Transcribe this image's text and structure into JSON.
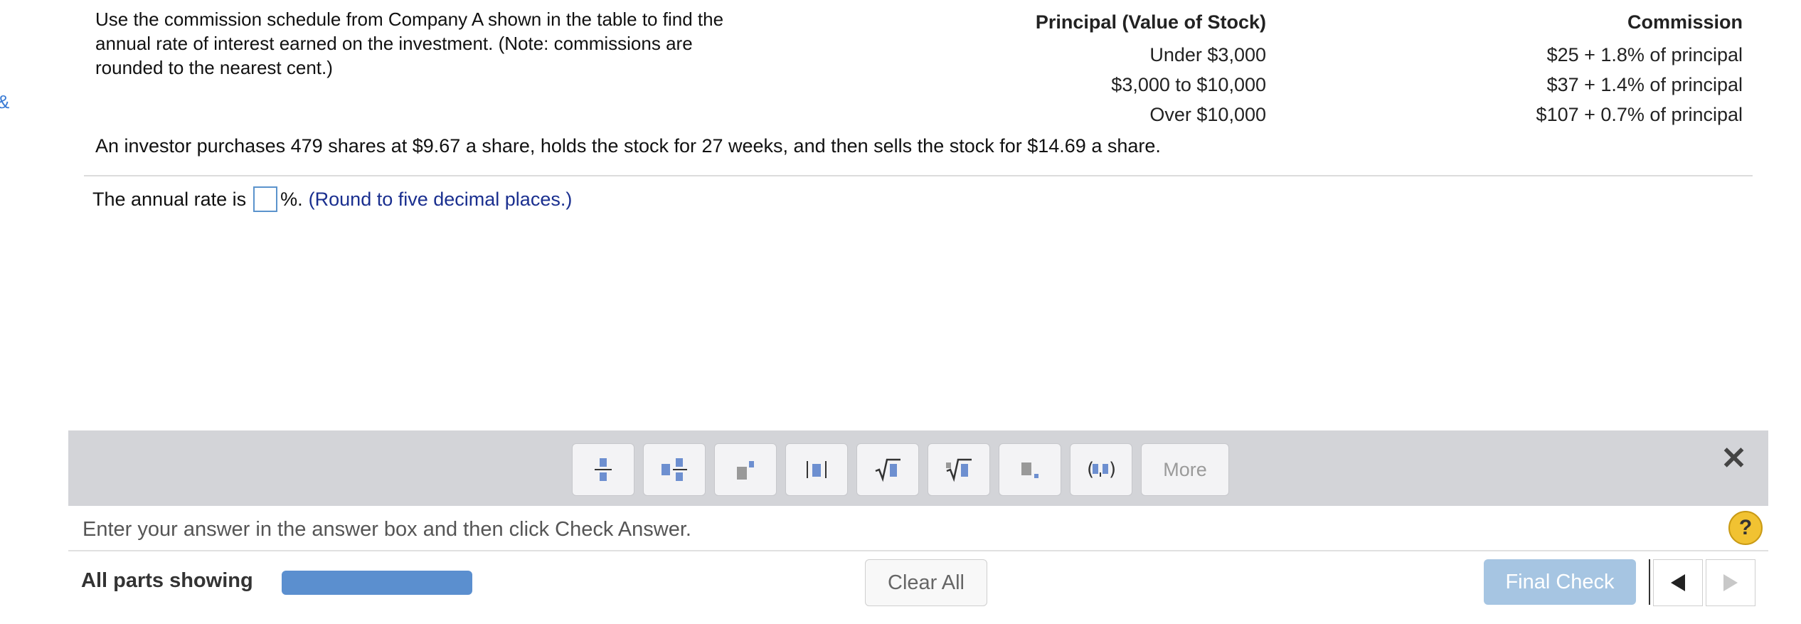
{
  "instructions": "Use the commission schedule from Company A shown in the table to find the annual rate of interest earned on the investment. (Note: commissions are rounded to the nearest cent.)",
  "table": {
    "headers": [
      "Principal (Value of Stock)",
      "Commission"
    ],
    "rows": [
      [
        "Under $3,000",
        "$25 + 1.8% of principal"
      ],
      [
        "$3,000 to $10,000",
        "$37 + 1.4% of principal"
      ],
      [
        "Over $10,000",
        "$107 + 0.7% of principal"
      ]
    ]
  },
  "problem": "An investor purchases 479 shares at $9.67 a share, holds the stock for 27 weeks, and then sells the stock for $14.69 a share.",
  "answer": {
    "prefix": "The annual rate is",
    "value": "",
    "suffix": "%.",
    "note": "(Round to five decimal places.)"
  },
  "toolbar": {
    "buttons": [
      {
        "icon": "fraction-icon"
      },
      {
        "icon": "mixed-number-icon"
      },
      {
        "icon": "exponent-icon"
      },
      {
        "icon": "absolute-value-icon"
      },
      {
        "icon": "square-root-icon"
      },
      {
        "icon": "nth-root-icon"
      },
      {
        "icon": "decimal-icon"
      },
      {
        "icon": "ordered-pair-icon"
      }
    ],
    "more_label": "More",
    "close_icon": "close-icon"
  },
  "hint": "Enter your answer in the answer box and then click Check Answer.",
  "help_label": "?",
  "footer": {
    "parts_label": "All parts showing",
    "progress": 1.0,
    "clear_all_label": "Clear All",
    "final_check_label": "Final Check"
  },
  "colors": {
    "accent": "#5b8fcf",
    "final_check_bg": "#a6c5e2",
    "toolbar_bg": "#d3d4d8",
    "note_text": "#1a2f8f",
    "help_bg": "#f1c232"
  }
}
